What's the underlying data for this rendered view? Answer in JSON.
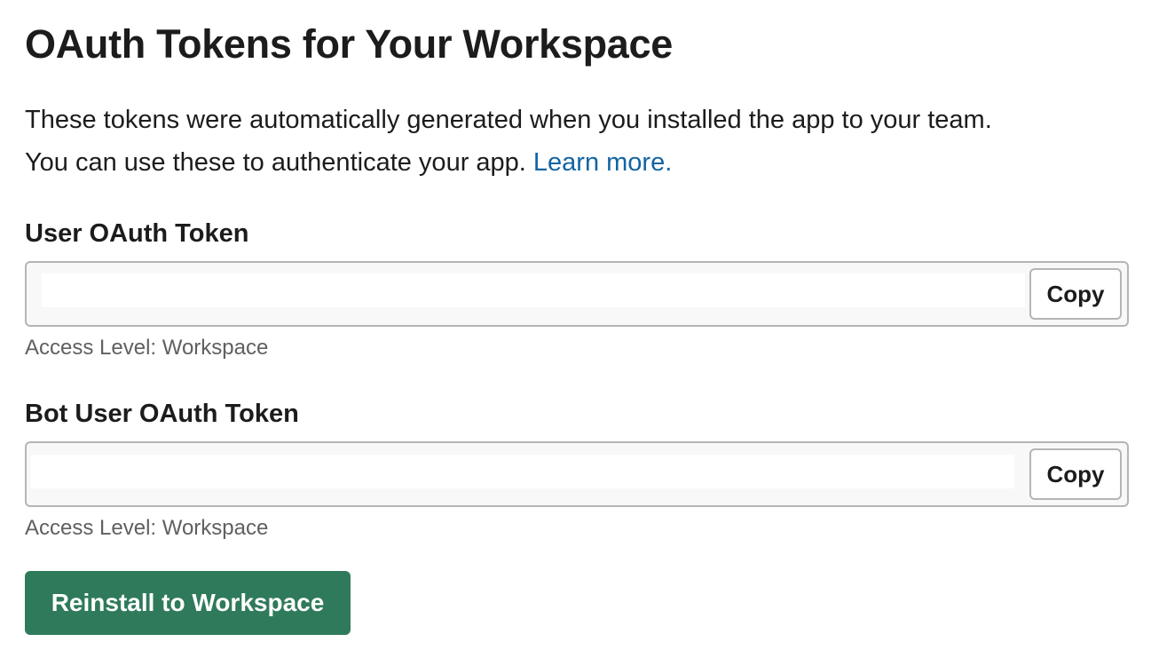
{
  "page": {
    "title": "OAuth Tokens for Your Workspace",
    "description_line1": "These tokens were automatically generated when you installed the app to your team.",
    "description_line2": "You can use these to authenticate your app.",
    "learn_more_label": "Learn more."
  },
  "user_token": {
    "label": "User OAuth Token",
    "value": "",
    "copy_label": "Copy",
    "access_level": "Access Level: Workspace"
  },
  "bot_token": {
    "label": "Bot User OAuth Token",
    "value": "",
    "copy_label": "Copy",
    "access_level": "Access Level: Workspace"
  },
  "actions": {
    "reinstall_label": "Reinstall to Workspace"
  },
  "colors": {
    "primary_button": "#2f7a5a",
    "link": "#1264a3",
    "text": "#1d1c1d",
    "muted_text": "#616061",
    "border": "#b5b5b5"
  }
}
